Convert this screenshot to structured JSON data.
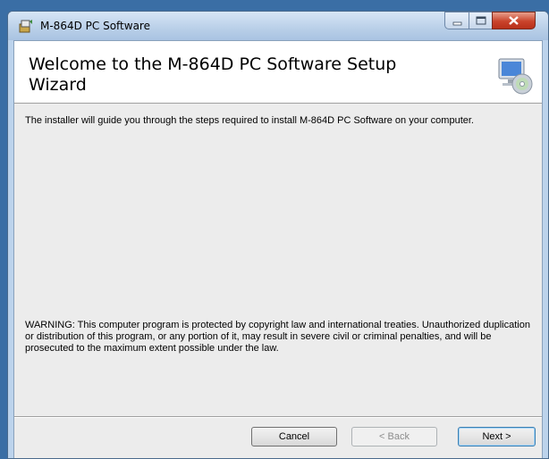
{
  "window": {
    "title": "M-864D PC Software"
  },
  "banner": {
    "title": "Welcome to the M-864D PC Software Setup Wizard",
    "icon": "setup-computer-icon"
  },
  "body": {
    "intro": "The installer will guide you through the steps required to install M-864D PC Software on your computer.",
    "warning": "WARNING: This computer program is protected by copyright law and international treaties. Unauthorized duplication or distribution of this program, or any portion of it, may result in severe civil or criminal penalties, and will be prosecuted to the maximum extent possible under the law."
  },
  "buttons": {
    "cancel": "Cancel",
    "back": "< Back",
    "next": "Next >"
  },
  "colors": {
    "close_button": "#c9432b",
    "titlebar": "#b9cfe8",
    "next_button_border": "#3c7fb1"
  }
}
